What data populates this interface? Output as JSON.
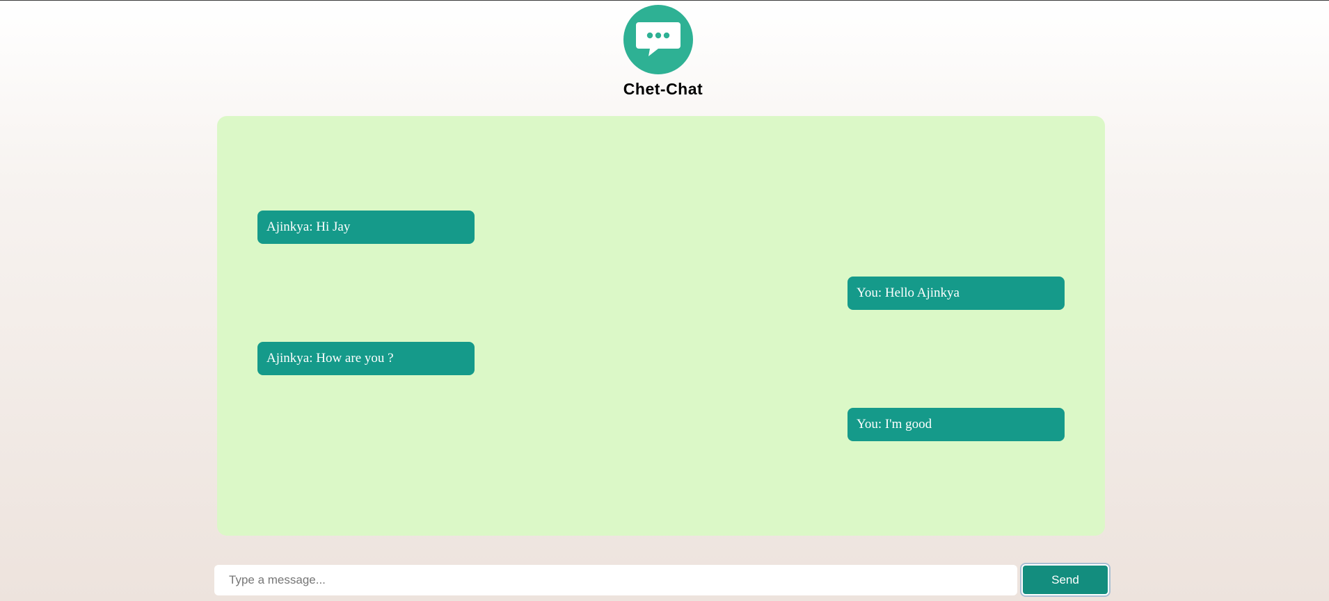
{
  "app": {
    "title": "Chet-Chat",
    "logo_icon": "chat-bubble-icon"
  },
  "colors": {
    "accent": "#2eb194",
    "bubble": "#159a8a",
    "panel": "#dbf8c7"
  },
  "messages": [
    {
      "text": "Ajinkya: Hi Jay",
      "side": "left"
    },
    {
      "text": "You: Hello Ajinkya",
      "side": "right"
    },
    {
      "text": "Ajinkya: How are you ?",
      "side": "left"
    },
    {
      "text": "You: I'm good",
      "side": "right"
    }
  ],
  "composer": {
    "placeholder": "Type a message...",
    "value": "",
    "send_label": "Send"
  }
}
